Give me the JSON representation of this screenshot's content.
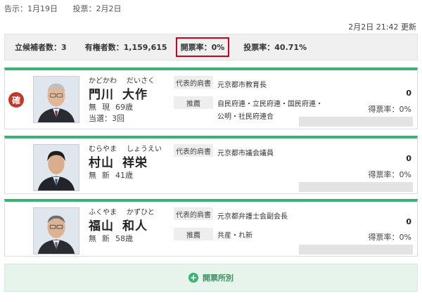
{
  "header": {
    "announcement": "告示：1月19日",
    "voting": "投票：2月2日",
    "updated": "2月2日 21:42 更新"
  },
  "summary": {
    "candidates": "立候補者数：3",
    "electorate": "有権者数：1,159,615",
    "count_rate": "開票率：0%",
    "turnout": "投票率：40.71%"
  },
  "candidates": [
    {
      "elected_mark": "確",
      "kana_family": "かどかわ",
      "kana_given": "だいさく",
      "family": "門川",
      "given": "大作",
      "status1": "無",
      "status2": "現",
      "age": "69歳",
      "terms": "当選：3回",
      "title_label": "代表的肩書",
      "title": "元京都市教育長",
      "party_label": "推薦",
      "parties": "自民府連・立民府連・国民府連・公明・社民府連合",
      "votes": "0",
      "vote_rate": "得票率：0%",
      "vote_share": 0
    },
    {
      "kana_family": "むらやま",
      "kana_given": "しょうえい",
      "family": "村山",
      "given": "祥栄",
      "status1": "無",
      "status2": "新",
      "age": "41歳",
      "title_label": "代表的肩書",
      "title": "元京都市議会議員",
      "votes": "0",
      "vote_rate": "得票率：0%",
      "vote_share": 0
    },
    {
      "kana_family": "ふくやま",
      "kana_given": "かずひと",
      "family": "福山",
      "given": "和人",
      "status1": "無",
      "status2": "新",
      "age": "58歳",
      "title_label": "代表的肩書",
      "title": "元京都弁護士会副会長",
      "party_label": "推薦",
      "parties": "共産・れ新",
      "votes": "0",
      "vote_rate": "得票率：0%",
      "vote_share": 0
    }
  ],
  "footer": {
    "plus_icon": "+",
    "button_label": "開票所別"
  },
  "colors": {
    "accent": "#3bb173",
    "highlight_border": "#d0021b",
    "elected_badge": "#c0392b"
  }
}
